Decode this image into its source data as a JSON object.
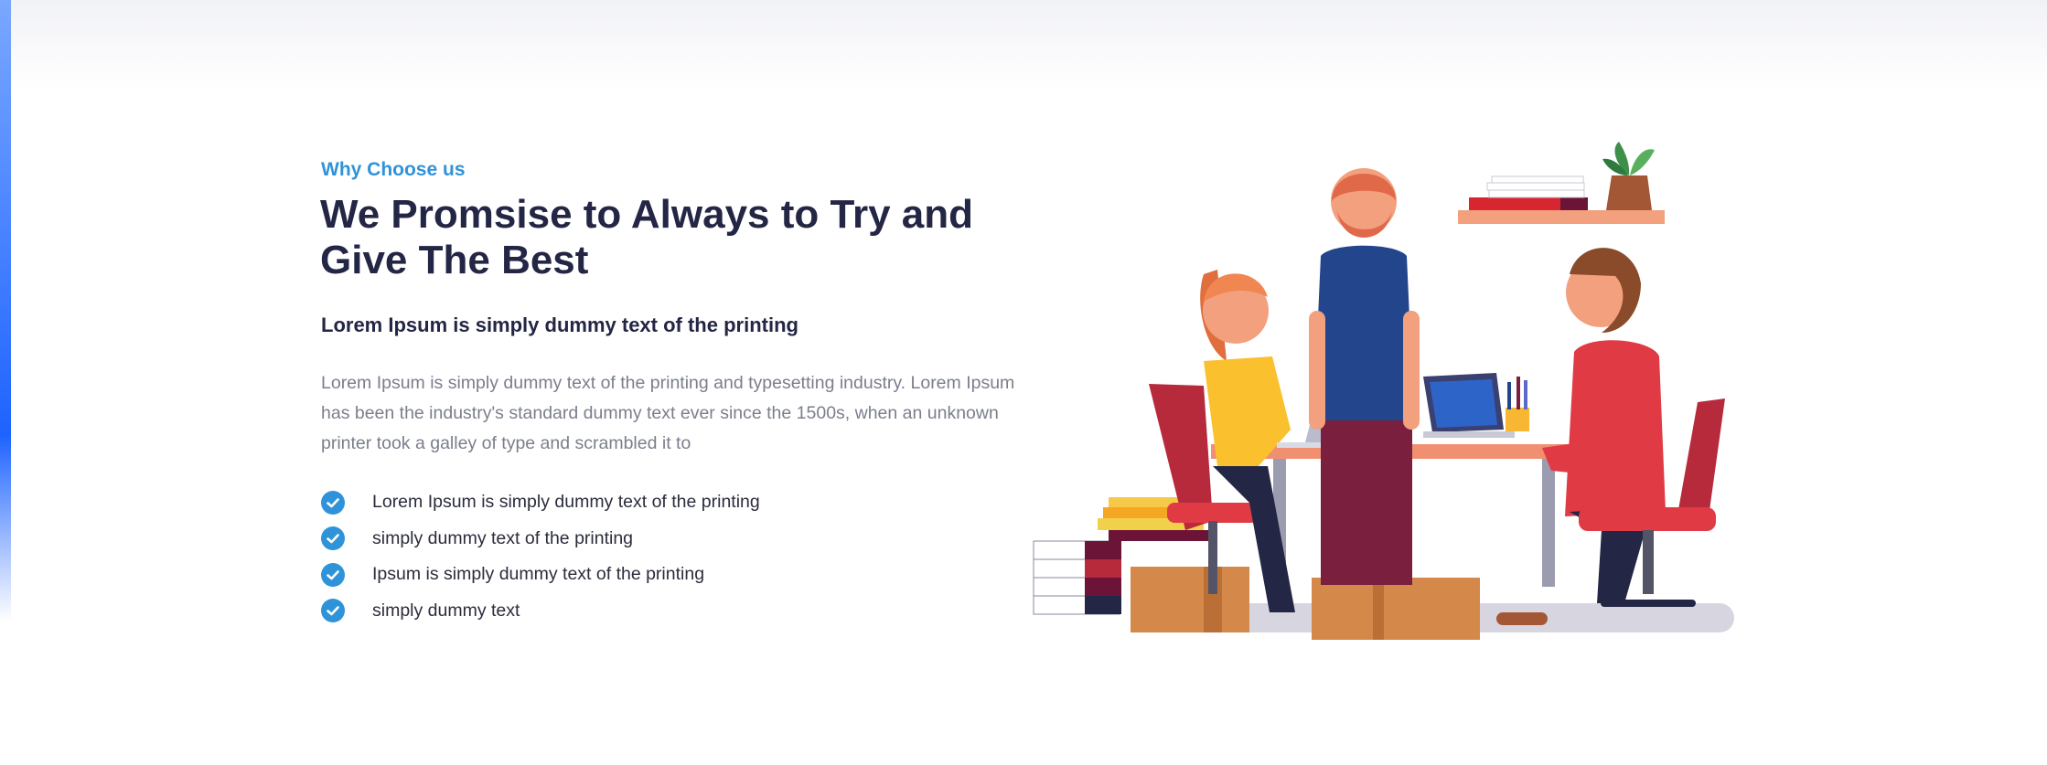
{
  "section": {
    "label": "Why Choose us",
    "headline": "We Promsise to Always to Try and Give The Best",
    "subhead": "Lorem Ipsum is simply dummy text of the printing",
    "body": "Lorem Ipsum is simply dummy text of the printing and typesetting industry. Lorem Ipsum has been the industry's standard dummy text ever since the 1500s, when an unknown printer took a galley of type and scrambled it to"
  },
  "checklist": [
    {
      "text": "Lorem Ipsum is simply dummy text of the printing"
    },
    {
      "text": "simply dummy text of the printing"
    },
    {
      "text": "Ipsum is simply dummy text of the printing"
    },
    {
      "text": "simply dummy text"
    }
  ],
  "icons": {
    "check": "check-circle-icon",
    "illustration": "team-working-illustration"
  },
  "colors": {
    "accent": "#2f93d9",
    "heading": "#232644",
    "body": "#7b7f8c"
  }
}
